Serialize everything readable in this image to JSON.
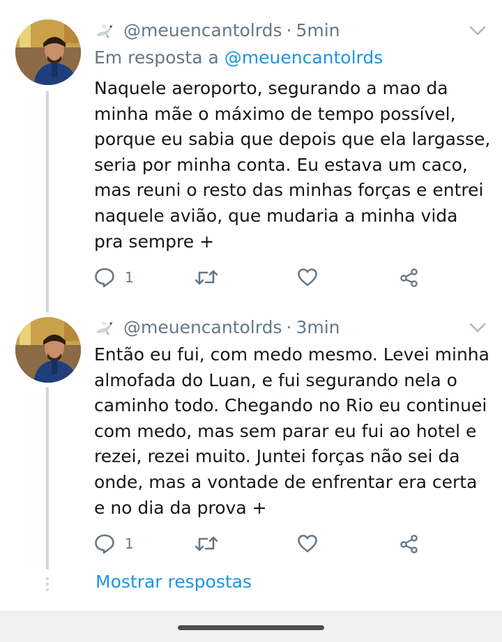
{
  "colors": {
    "accent": "#1b95e0",
    "muted": "#657786",
    "text": "#14171a",
    "thread_line": "#ccd6dd"
  },
  "tweets": [
    {
      "handle": "@meuencantolrds",
      "separator": "·",
      "time": "5min",
      "reply_prefix": "Em resposta a",
      "reply_mention": "@meuencantolrds",
      "text": "Naquele aeroporto, segurando a mao da minha mãe o máximo de tempo possível, porque eu sabia que depois que ela largasse, seria por minha conta. Eu estava um caco, mas reuni o resto das minhas forças e entrei naquele avião, que mudaria a minha vida pra sempre +",
      "reply_count": "1",
      "icons": [
        "dove-icon",
        "chevron-down-icon",
        "reply-icon",
        "retweet-icon",
        "like-icon",
        "share-icon"
      ]
    },
    {
      "handle": "@meuencantolrds",
      "separator": "·",
      "time": "3min",
      "text": "Então eu fui, com medo mesmo. Levei minha almofada do Luan, e fui segurando nela o caminho todo. Chegando no Rio eu continuei com medo, mas sem parar eu fui ao hotel e rezei, rezei muito. Juntei forças não sei da onde, mas a vontade de enfrentar era certa e no dia da prova +",
      "reply_count": "1",
      "icons": [
        "dove-icon",
        "chevron-down-icon",
        "reply-icon",
        "retweet-icon",
        "like-icon",
        "share-icon"
      ]
    }
  ],
  "show_replies_label": "Mostrar respostas"
}
